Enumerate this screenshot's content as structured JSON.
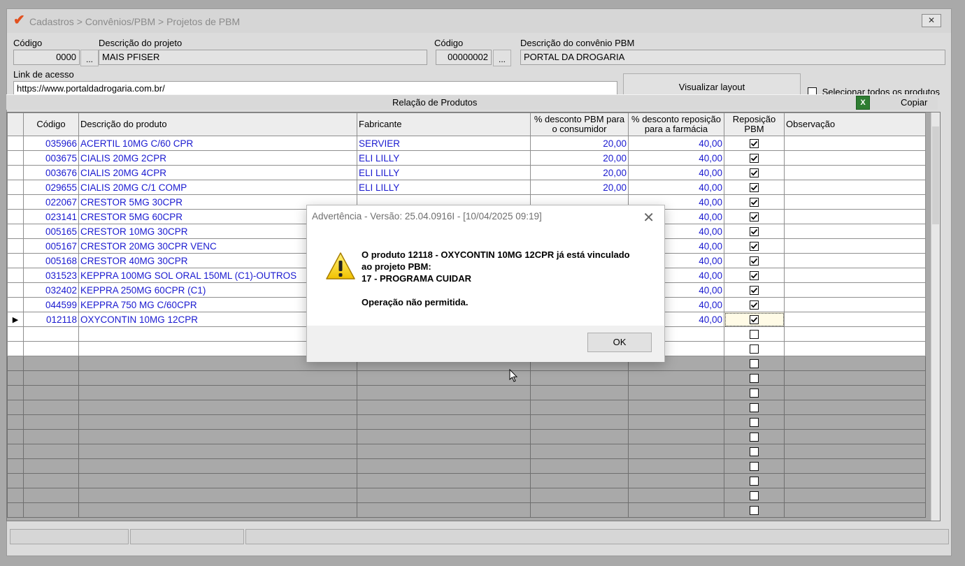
{
  "window": {
    "title": "Cadastros > Convênios/PBM > Projetos de PBM",
    "close_label": "✕"
  },
  "form": {
    "codigo_label": "Código",
    "codigo_value": "0000",
    "dots_label": "...",
    "descricao_projeto_label": "Descrição do projeto",
    "descricao_projeto_value": "MAIS PFISER",
    "codigo_convenio_label": "Código",
    "codigo_convenio_value": "00000002",
    "descricao_convenio_label": "Descrição do convênio PBM",
    "descricao_convenio_value": "PORTAL DA DROGARIA",
    "link_label": "Link de acesso",
    "link_value": "https://www.portaldadrogaria.com.br/",
    "visualizar_label": "Visualizar layout",
    "selecionar_label": "Selecionar todos os produtos"
  },
  "section": {
    "title": "Relação de Produtos",
    "copiar_label": "Copiar"
  },
  "table": {
    "headers": {
      "codigo": "Código",
      "descricao": "Descrição do produto",
      "fabricante": "Fabricante",
      "desc_consumidor_1": "% desconto PBM para",
      "desc_consumidor_2": "o consumidor",
      "desc_farmacia_1": "% desconto reposição",
      "desc_farmacia_2": "para a farmácia",
      "reposicao_1": "Reposição",
      "reposicao_2": "PBM",
      "observacao": "Observação"
    },
    "rows": [
      {
        "codigo": "035966",
        "descricao": "ACERTIL 10MG C/60 CPR",
        "fabricante": "SERVIER",
        "desc_consumidor": "20,00",
        "desc_farmacia": "40,00",
        "checked": true
      },
      {
        "codigo": "003675",
        "descricao": "CIALIS 20MG 2CPR",
        "fabricante": "ELI LILLY",
        "desc_consumidor": "20,00",
        "desc_farmacia": "40,00",
        "checked": true
      },
      {
        "codigo": "003676",
        "descricao": "CIALIS 20MG 4CPR",
        "fabricante": "ELI LILLY",
        "desc_consumidor": "20,00",
        "desc_farmacia": "40,00",
        "checked": true
      },
      {
        "codigo": "029655",
        "descricao": "CIALIS 20MG C/1 COMP",
        "fabricante": "ELI LILLY",
        "desc_consumidor": "20,00",
        "desc_farmacia": "40,00",
        "checked": true
      },
      {
        "codigo": "022067",
        "descricao": "CRESTOR  5MG 30CPR",
        "fabricante": "",
        "desc_consumidor": "",
        "desc_farmacia": "40,00",
        "checked": true
      },
      {
        "codigo": "023141",
        "descricao": "CRESTOR  5MG 60CPR",
        "fabricante": "",
        "desc_consumidor": "",
        "desc_farmacia": "40,00",
        "checked": true
      },
      {
        "codigo": "005165",
        "descricao": "CRESTOR 10MG 30CPR",
        "fabricante": "",
        "desc_consumidor": "",
        "desc_farmacia": "40,00",
        "checked": true
      },
      {
        "codigo": "005167",
        "descricao": "CRESTOR 20MG 30CPR VENC",
        "fabricante": "",
        "desc_consumidor": "",
        "desc_farmacia": "40,00",
        "checked": true
      },
      {
        "codigo": "005168",
        "descricao": "CRESTOR 40MG 30CPR",
        "fabricante": "",
        "desc_consumidor": "",
        "desc_farmacia": "40,00",
        "checked": true
      },
      {
        "codigo": "031523",
        "descricao": "KEPPRA 100MG SOL ORAL 150ML (C1)-OUTROS",
        "fabricante": "",
        "desc_consumidor": "",
        "desc_farmacia": "40,00",
        "checked": true
      },
      {
        "codigo": "032402",
        "descricao": "KEPPRA 250MG 60CPR (C1)",
        "fabricante": "",
        "desc_consumidor": "",
        "desc_farmacia": "40,00",
        "checked": true
      },
      {
        "codigo": "044599",
        "descricao": "KEPPRA 750 MG C/60CPR",
        "fabricante": "",
        "desc_consumidor": "",
        "desc_farmacia": "40,00",
        "checked": true
      },
      {
        "codigo": "012118",
        "descricao": "OXYCONTIN 10MG  12CPR",
        "fabricante": "",
        "desc_consumidor": "",
        "desc_farmacia": "40,00",
        "checked": true,
        "current": true
      }
    ],
    "current_row_marker": "▶"
  },
  "dialog": {
    "title": "Advertência - Versão: 25.04.0916I - [10/04/2025 09:19]",
    "close_label": "✕",
    "line1": "O produto 12118 - OXYCONTIN 10MG  12CPR já está vinculado",
    "line2": "ao projeto PBM:",
    "line3": "17 - PROGRAMA CUIDAR",
    "line4": "Operação não permitida.",
    "ok_label": "OK"
  },
  "icons": {
    "title_icon": "checkmark-logo-icon",
    "warning_icon": "warning-icon",
    "excel_icon": "excel-icon",
    "cursor": "mouse-cursor-icon"
  }
}
